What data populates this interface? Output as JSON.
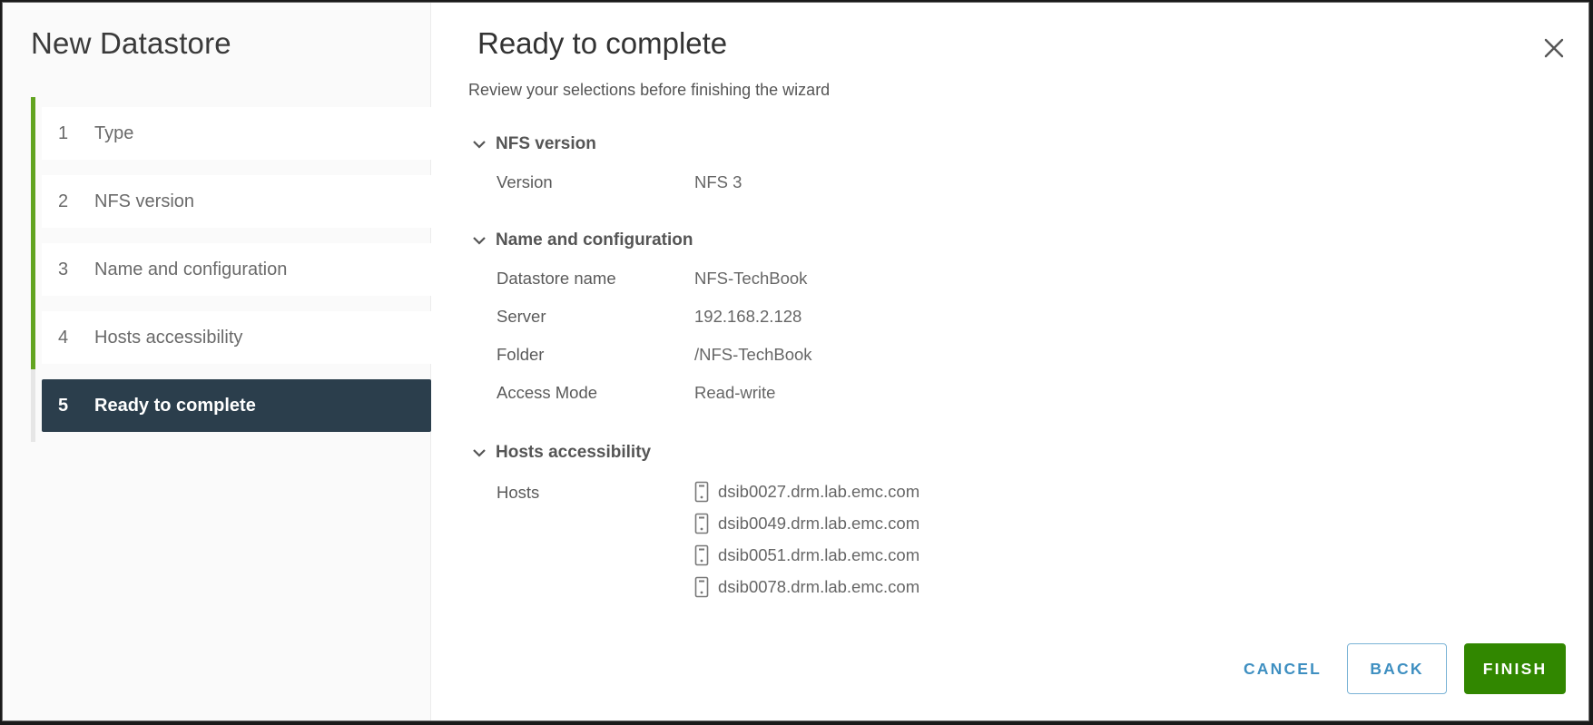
{
  "sidebar": {
    "title": "New Datastore",
    "progress_completed_steps": 4,
    "steps": [
      {
        "num": "1",
        "label": "Type"
      },
      {
        "num": "2",
        "label": "NFS version"
      },
      {
        "num": "3",
        "label": "Name and configuration"
      },
      {
        "num": "4",
        "label": "Hosts accessibility"
      },
      {
        "num": "5",
        "label": "Ready to complete",
        "active": true
      }
    ]
  },
  "main": {
    "title": "Ready to complete",
    "subtitle": "Review your selections before finishing the wizard",
    "sections": {
      "nfs_version": {
        "title": "NFS version",
        "rows": [
          {
            "key": "Version",
            "value": "NFS 3"
          }
        ]
      },
      "name_config": {
        "title": "Name and configuration",
        "rows": [
          {
            "key": "Datastore name",
            "value": "NFS-TechBook"
          },
          {
            "key": "Server",
            "value": "192.168.2.128"
          },
          {
            "key": "Folder",
            "value": "/NFS-TechBook"
          },
          {
            "key": "Access Mode",
            "value": "Read-write"
          }
        ]
      },
      "hosts_access": {
        "title": "Hosts accessibility",
        "key": "Hosts",
        "hosts": [
          "dsib0027.drm.lab.emc.com",
          "dsib0049.drm.lab.emc.com",
          "dsib0051.drm.lab.emc.com",
          "dsib0078.drm.lab.emc.com"
        ]
      }
    }
  },
  "icons": {
    "close": "close-icon",
    "chevron": "chevron-down-icon",
    "host": "host-server-icon"
  },
  "footer": {
    "cancel_label": "CANCEL",
    "back_label": "BACK",
    "finish_label": "FINISH"
  },
  "colors": {
    "accent_green": "#62a420",
    "active_step_bg": "#2b3e4c",
    "finish_bg": "#318700",
    "link_blue": "#3e8fc1"
  }
}
